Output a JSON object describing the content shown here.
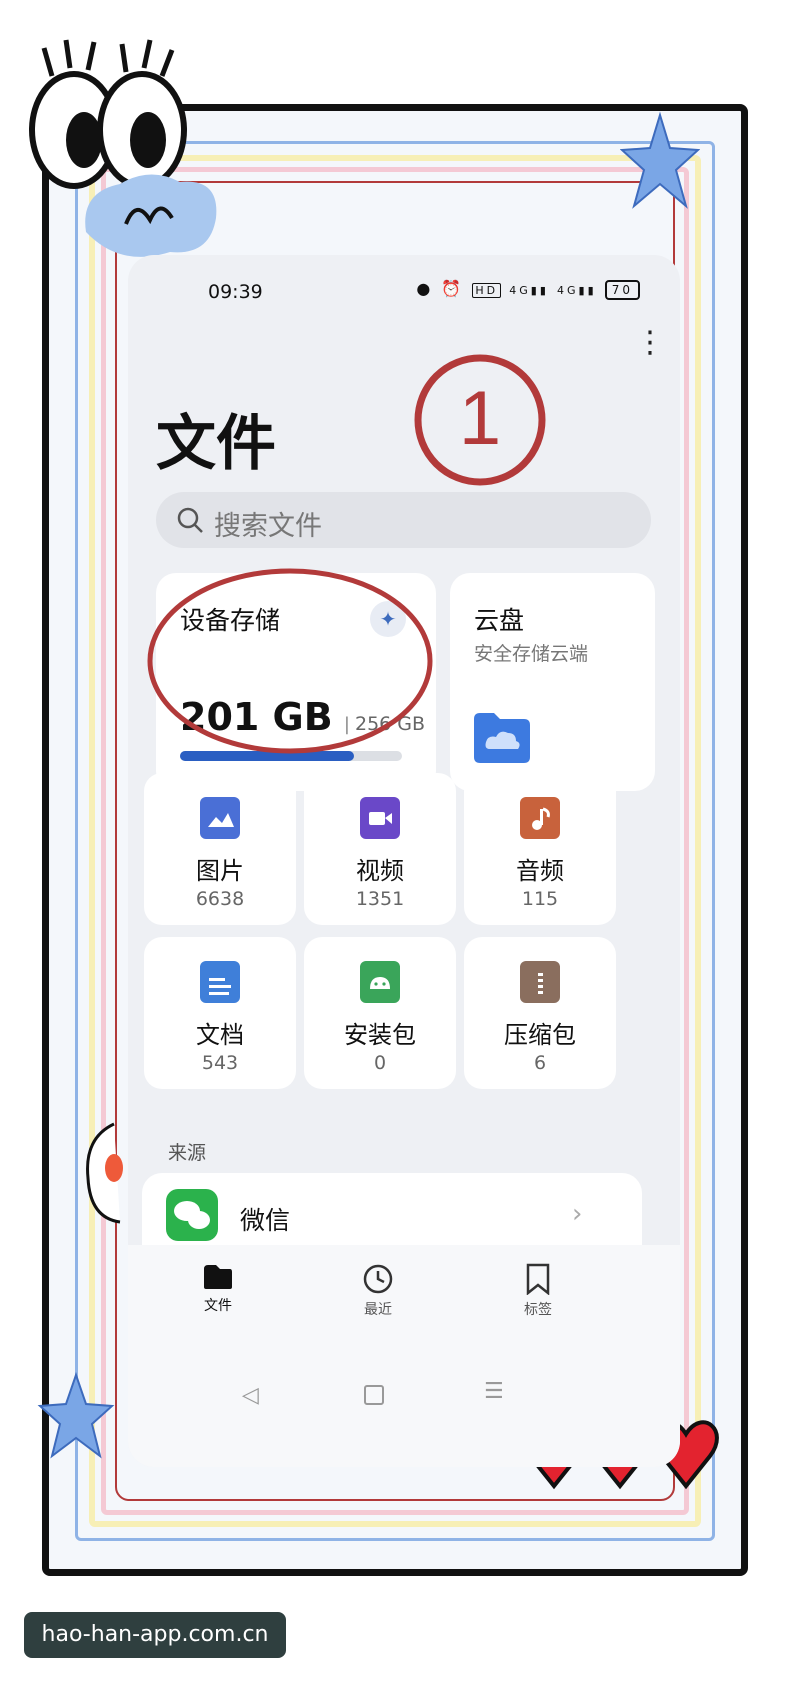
{
  "status_bar": {
    "time": "09:39",
    "signal_left": "4G",
    "signal_right": "4G",
    "battery": "70"
  },
  "page_title": "文件",
  "search": {
    "placeholder": "搜索文件"
  },
  "storage": {
    "title": "设备存储",
    "used": "201 GB",
    "total": "256 GB",
    "used_fraction": 0.785
  },
  "cloud": {
    "title": "云盘",
    "subtitle": "安全存储云端"
  },
  "categories": [
    {
      "label": "图片",
      "count": "6638",
      "icon": "image-icon",
      "color": "#4a6fd6"
    },
    {
      "label": "视频",
      "count": "1351",
      "icon": "video-icon",
      "color": "#6a48c8"
    },
    {
      "label": "音频",
      "count": "115",
      "icon": "music-icon",
      "color": "#c8623c"
    },
    {
      "label": "文档",
      "count": "543",
      "icon": "document-icon",
      "color": "#3f7fd9"
    },
    {
      "label": "安装包",
      "count": "0",
      "icon": "android-icon",
      "color": "#3aa55a"
    },
    {
      "label": "压缩包",
      "count": "6",
      "icon": "archive-icon",
      "color": "#8a6e5e"
    }
  ],
  "source": {
    "label": "来源",
    "wechat": "微信"
  },
  "bottom_nav": {
    "files": "文件",
    "recent": "最近",
    "bookmarks": "标签"
  },
  "annotation": {
    "number": "1",
    "color": "#b23a3a"
  },
  "watermark": "hao-han-app.com.cn"
}
